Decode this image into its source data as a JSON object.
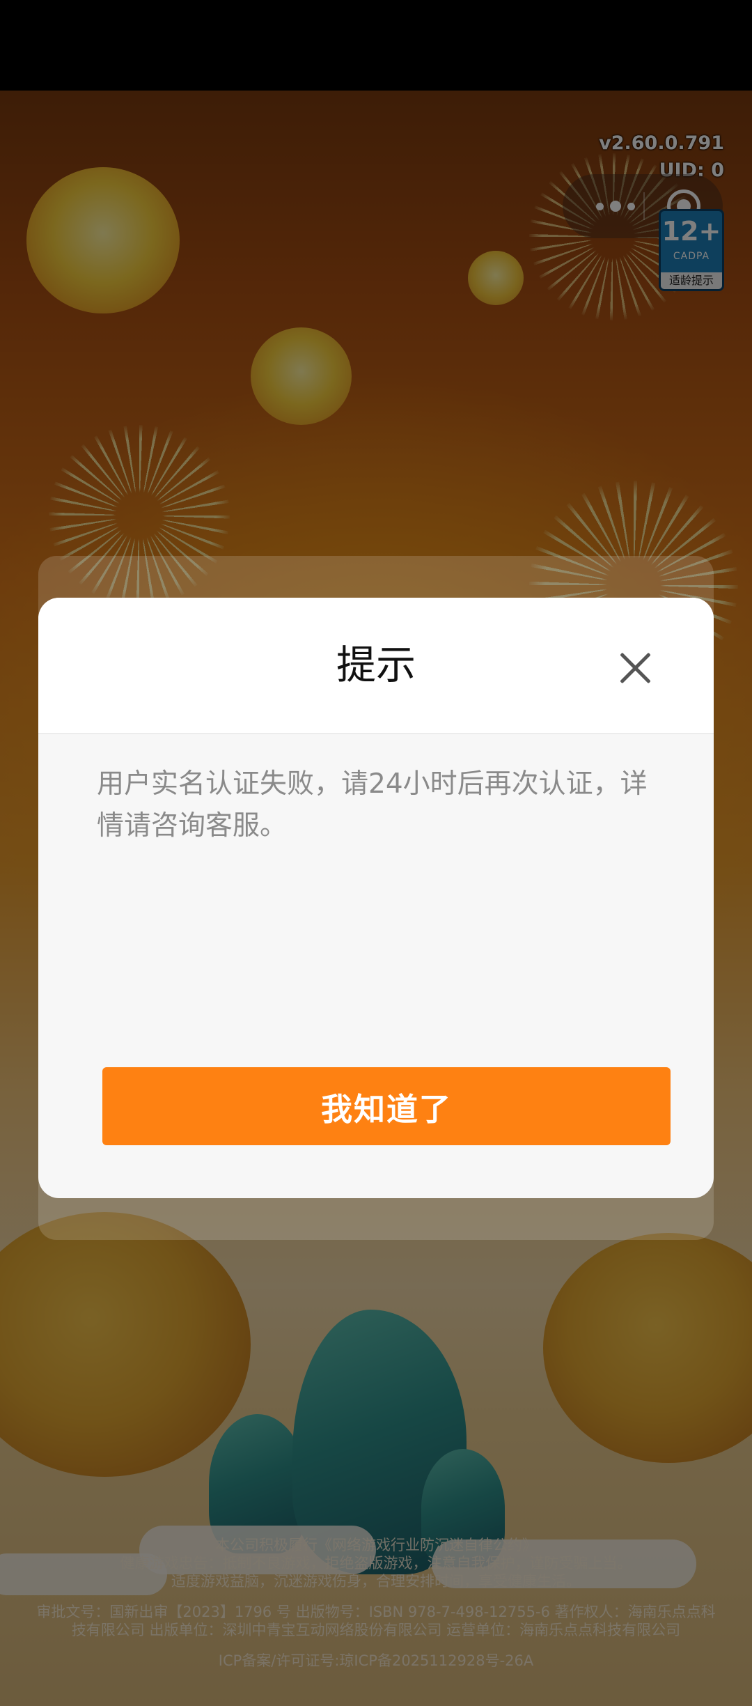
{
  "version": "v2.60.0.791",
  "uid": "UID: 0",
  "capsule": {
    "more_icon": "more-dots-icon",
    "close_icon": "target-circle-icon"
  },
  "age_rating": {
    "age": "12+",
    "org": "CADPA",
    "tip": "适龄提示"
  },
  "dialog": {
    "title": "提示",
    "message": "用户实名认证失败，请24小时后再次认证，详情请咨询客服。",
    "button": "我知道了",
    "close_icon": "close-icon",
    "button_color": "#fe8112"
  },
  "footer": {
    "line1": "本公司积极履行《网络游戏行业防沉迷自律公约》",
    "line2": "健康游戏忠告：抵制不良游戏，拒绝盗版游戏，注意自我保护，谨防受骗上当。",
    "line3": "适度游戏益脑，沉迷游戏伤身，合理安排时间，享受健康生活。",
    "line4": "审批文号：国新出审【2023】1796 号 出版物号：ISBN 978-7-498-12755-6 著作权人：海南乐点点科",
    "line5": "技有限公司 出版单位：深圳中青宝互动网络股份有限公司 运营单位：海南乐点点科技有限公司",
    "icp": "ICP备案/许可证号:琼ICP备2025112928号-26A"
  }
}
